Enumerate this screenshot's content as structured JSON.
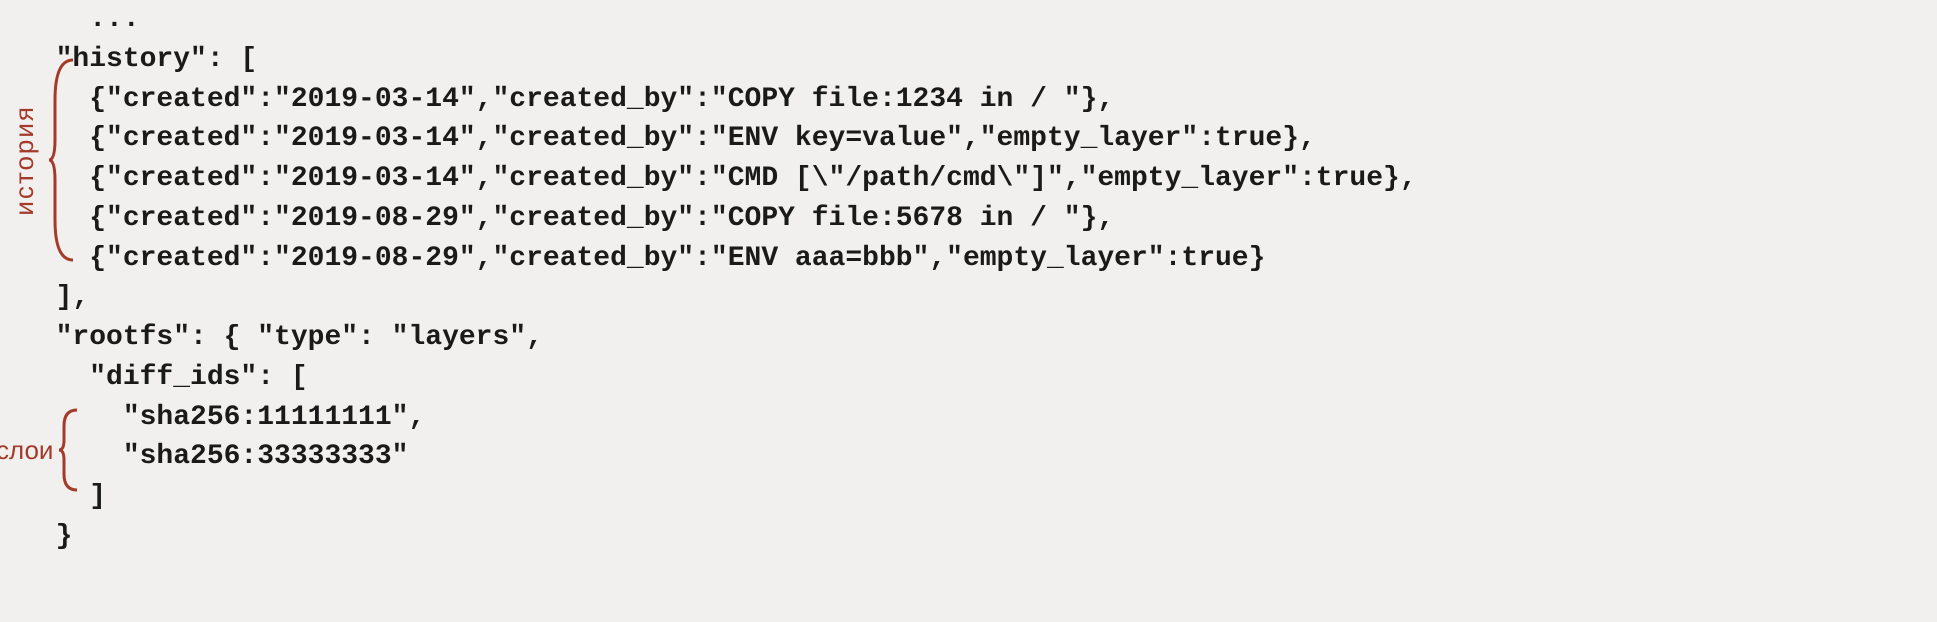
{
  "annotations": {
    "history_label": "история",
    "layers_label": "слои"
  },
  "code": {
    "ellipsis": "    ...",
    "history_key": "  \"history\": [",
    "history_items": [
      "    {\"created\":\"2019-03-14\",\"created_by\":\"COPY file:1234 in / \"},",
      "    {\"created\":\"2019-03-14\",\"created_by\":\"ENV key=value\",\"empty_layer\":true},",
      "    {\"created\":\"2019-03-14\",\"created_by\":\"CMD [\\\"/path/cmd\\\"]\",\"empty_layer\":true},",
      "    {\"created\":\"2019-08-29\",\"created_by\":\"COPY file:5678 in / \"},",
      "    {\"created\":\"2019-08-29\",\"created_by\":\"ENV aaa=bbb\",\"empty_layer\":true}"
    ],
    "history_close": "  ],",
    "rootfs_open": "  \"rootfs\": { \"type\": \"layers\",",
    "diff_ids_open": "    \"diff_ids\": [",
    "diff_ids": [
      "      \"sha256:11111111\",",
      "      \"sha256:33333333\""
    ],
    "diff_ids_close": "    ]",
    "rootfs_close": "  }"
  }
}
